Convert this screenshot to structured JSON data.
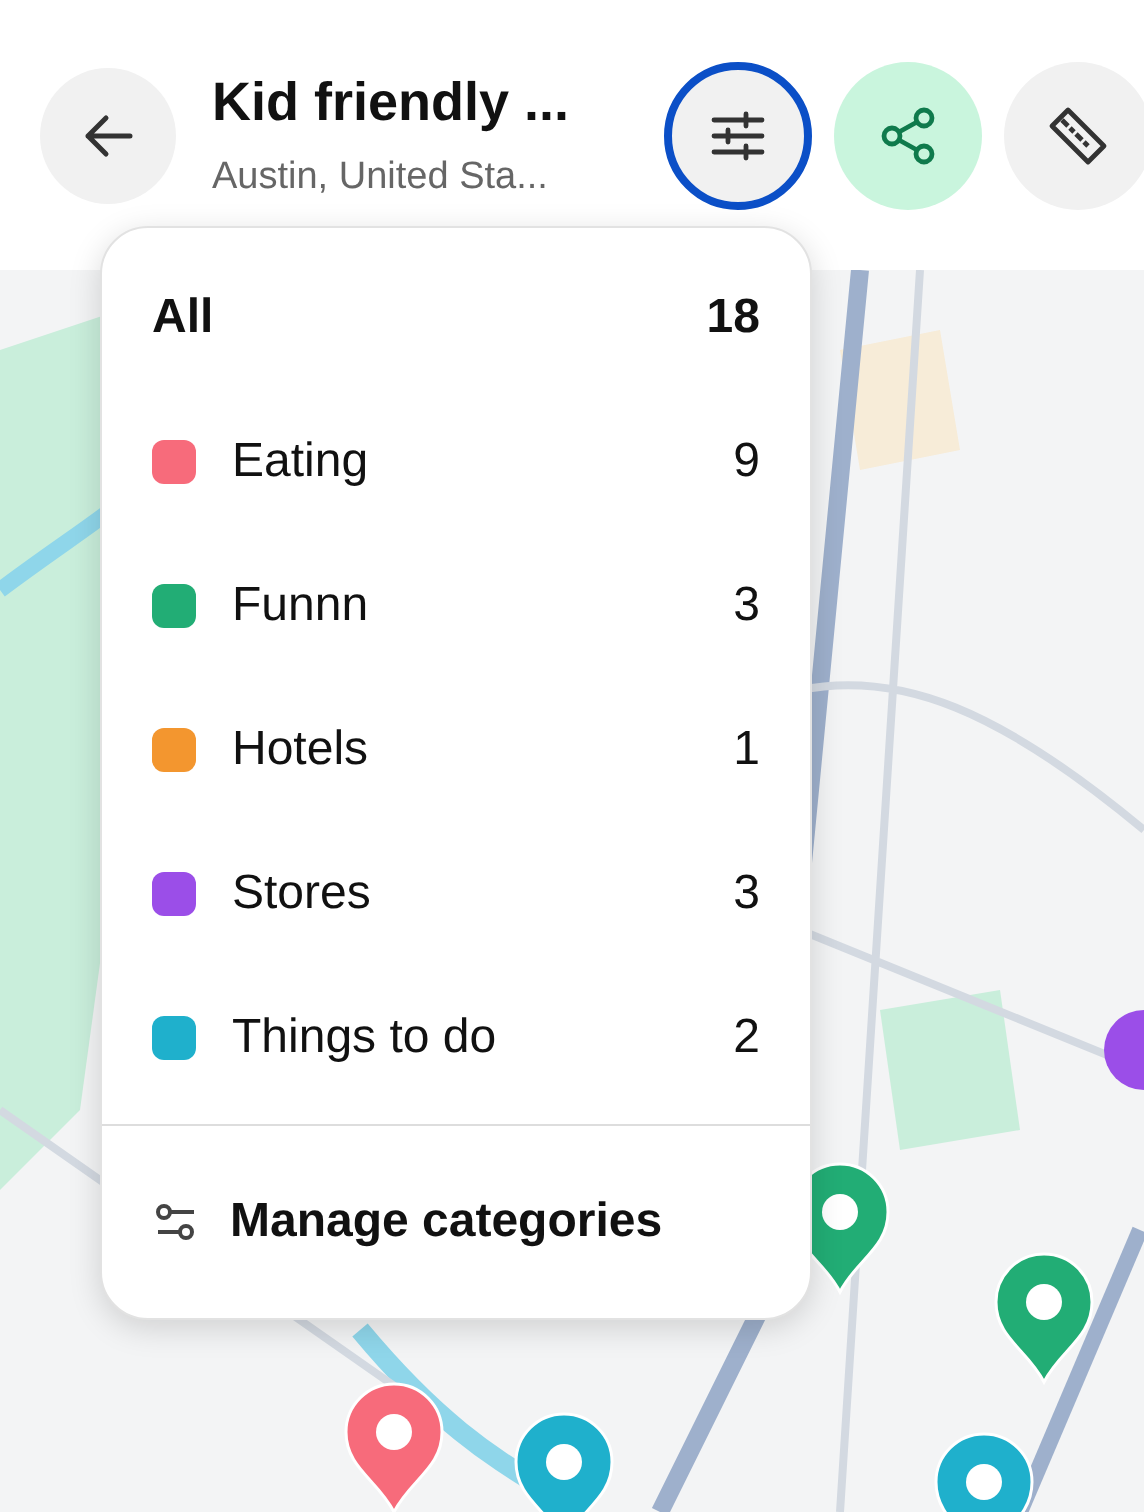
{
  "header": {
    "title": "Kid friendly ...",
    "subtitle": "Austin, United Sta..."
  },
  "buttons": [
    {
      "kind": "filter",
      "selected": true
    },
    {
      "kind": "share",
      "selected": false
    },
    {
      "kind": "ruler",
      "selected": false
    }
  ],
  "menu": {
    "all": {
      "label": "All",
      "count": "18"
    },
    "categories": [
      {
        "label": "Eating",
        "count": "9",
        "color": "#f76b7b"
      },
      {
        "label": "Funnn",
        "count": "3",
        "color": "#22ad75"
      },
      {
        "label": "Hotels",
        "count": "1",
        "color": "#f3962f"
      },
      {
        "label": "Stores",
        "count": "3",
        "color": "#9b4ee8"
      },
      {
        "label": "Things to do",
        "count": "2",
        "color": "#1fb0cc"
      }
    ],
    "manage": "Manage categories"
  }
}
